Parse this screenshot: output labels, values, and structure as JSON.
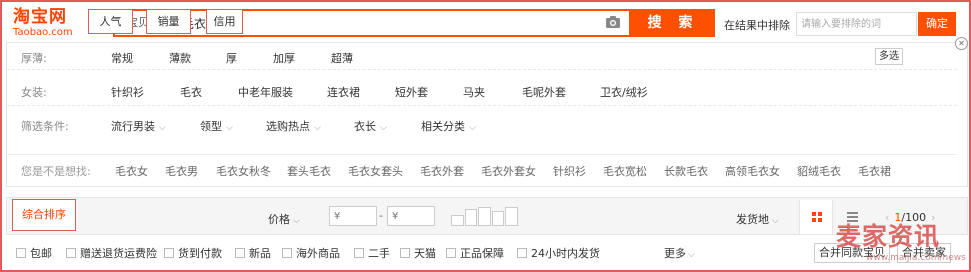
{
  "header": {
    "logo_cn": "淘宝网",
    "logo_en": "Taobao.com",
    "search_type": "宝贝",
    "search_value": "毛衣",
    "search_button": "搜 索",
    "exclude_label": "在结果中排除",
    "exclude_placeholder": "请输入要排除的词",
    "exclude_button": "确定"
  },
  "filters": {
    "thickness": {
      "label": "厚薄:",
      "items": [
        "常规",
        "薄款",
        "厚",
        "加厚",
        "超薄"
      ],
      "multi_select": "多选"
    },
    "womens": {
      "label": "女装:",
      "items": [
        "针织衫",
        "毛衣",
        "中老年服装",
        "连衣裙",
        "短外套",
        "马夹",
        "毛呢外套",
        "卫衣/绒衫"
      ]
    },
    "conditions": {
      "label": "筛选条件:",
      "items": [
        "流行男装",
        "领型",
        "选购热点",
        "衣长",
        "相关分类"
      ]
    },
    "suggestions": {
      "label": "您是不是想找:",
      "items": [
        "毛衣女",
        "毛衣男",
        "毛衣女秋冬",
        "套头毛衣",
        "毛衣女套头",
        "毛衣外套",
        "毛衣外套女",
        "针织衫",
        "毛衣宽松",
        "长款毛衣",
        "高领毛衣女",
        "貂绒毛衣",
        "毛衣裙"
      ]
    }
  },
  "sortbar": {
    "buttons": [
      "综合排序",
      "人气",
      "销量",
      "信用"
    ],
    "price_label": "价格",
    "price_min_placeholder": "¥",
    "price_max_placeholder": "¥",
    "ship_from": "发货地",
    "page_current": "1",
    "page_total": "/100"
  },
  "options": {
    "checkboxes": [
      "包邮",
      "赠送退货运费险",
      "货到付款",
      "新品",
      "海外商品",
      "二手",
      "天猫",
      "正品保障",
      "24小时内发货"
    ],
    "more": "更多",
    "merge_same": "合并同款宝贝",
    "merge_seller": "合并卖家"
  },
  "watermark": {
    "text": "麦家资讯",
    "url": "www.maijia.com/news"
  },
  "colors": {
    "brand": "#ff5000",
    "active": "#ff4400",
    "frame": "#e15b5b"
  }
}
